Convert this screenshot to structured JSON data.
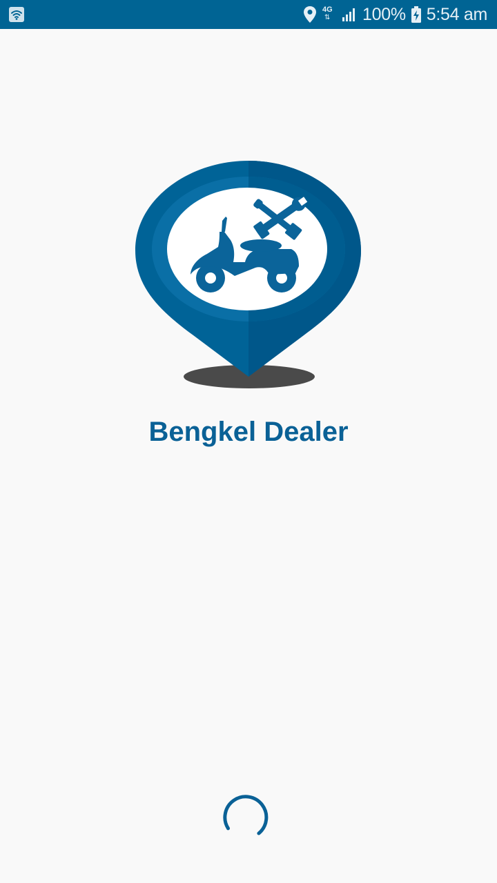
{
  "status_bar": {
    "network_type": "4G",
    "battery_percent": "100%",
    "time": "5:54 am",
    "icons": [
      "wifi-icon",
      "location-icon",
      "network-icon",
      "signal-icon",
      "battery-charging-icon"
    ],
    "background_color": "#006494"
  },
  "splash": {
    "app_name": "Bengkel Dealer",
    "logo_icon": "map-pin-scooter-tools-logo",
    "title_color": "#0a6196"
  },
  "loading": {
    "indicator_icon": "loading-spinner-icon",
    "color": "#0a6196"
  }
}
